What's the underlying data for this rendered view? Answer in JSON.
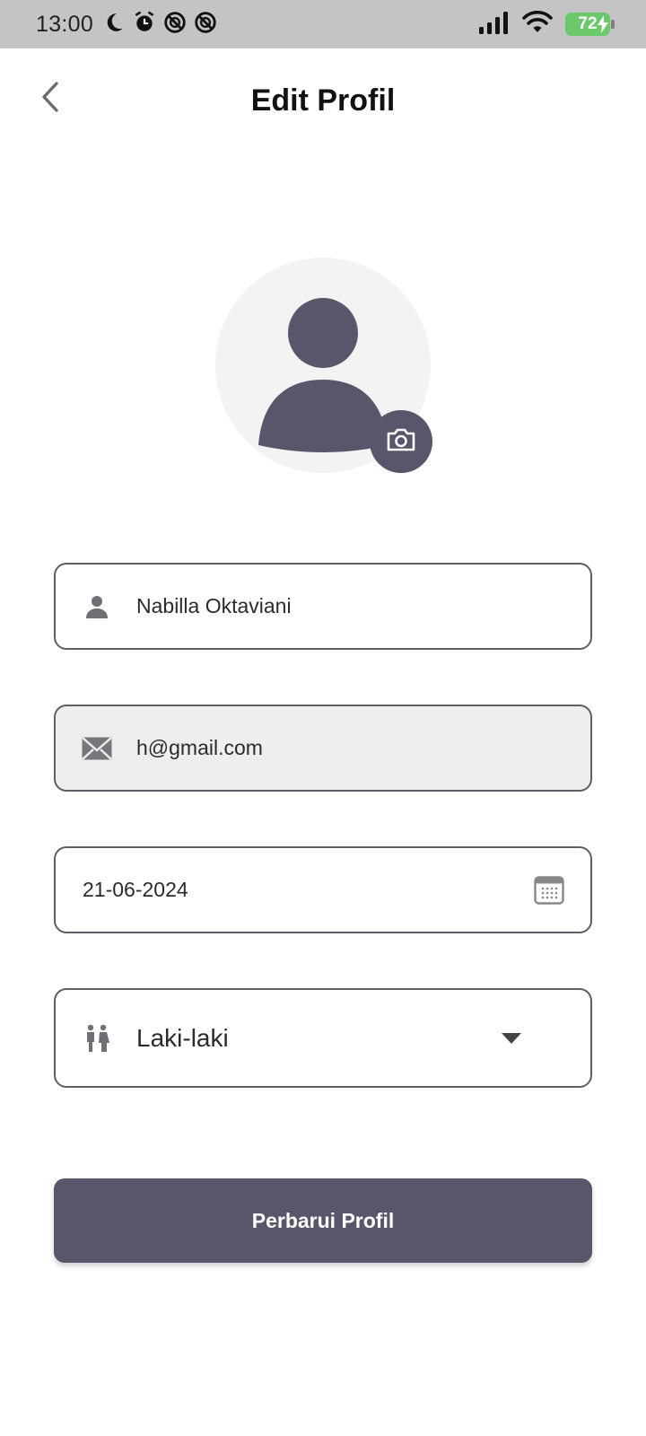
{
  "status_bar": {
    "time": "13:00",
    "battery": "72",
    "icons": [
      "moon-icon",
      "alarm-icon",
      "no-disturb-icon",
      "no-disturb-icon",
      "signal-icon",
      "wifi-icon",
      "battery-charging-icon"
    ]
  },
  "header": {
    "title": "Edit Profil",
    "back_icon": "chevron-left-icon"
  },
  "avatar": {
    "placeholder_icon": "person-icon",
    "camera_icon": "camera-icon"
  },
  "form": {
    "name": {
      "value": "Nabilla Oktaviani",
      "icon": "person-icon"
    },
    "email": {
      "value": "h@gmail.com",
      "icon": "mail-icon",
      "disabled": true
    },
    "birthdate": {
      "value": "21-06-2024",
      "icon": "calendar-icon"
    },
    "gender": {
      "value": "Laki-laki",
      "icon": "gender-icon",
      "dropdown_icon": "caret-down-icon"
    }
  },
  "submit": {
    "label": "Perbarui Profil"
  },
  "colors": {
    "primary": "#58566b",
    "status_bar": "#c4c4c4",
    "battery": "#6bc96b",
    "disabled_field": "#eeeeee"
  }
}
